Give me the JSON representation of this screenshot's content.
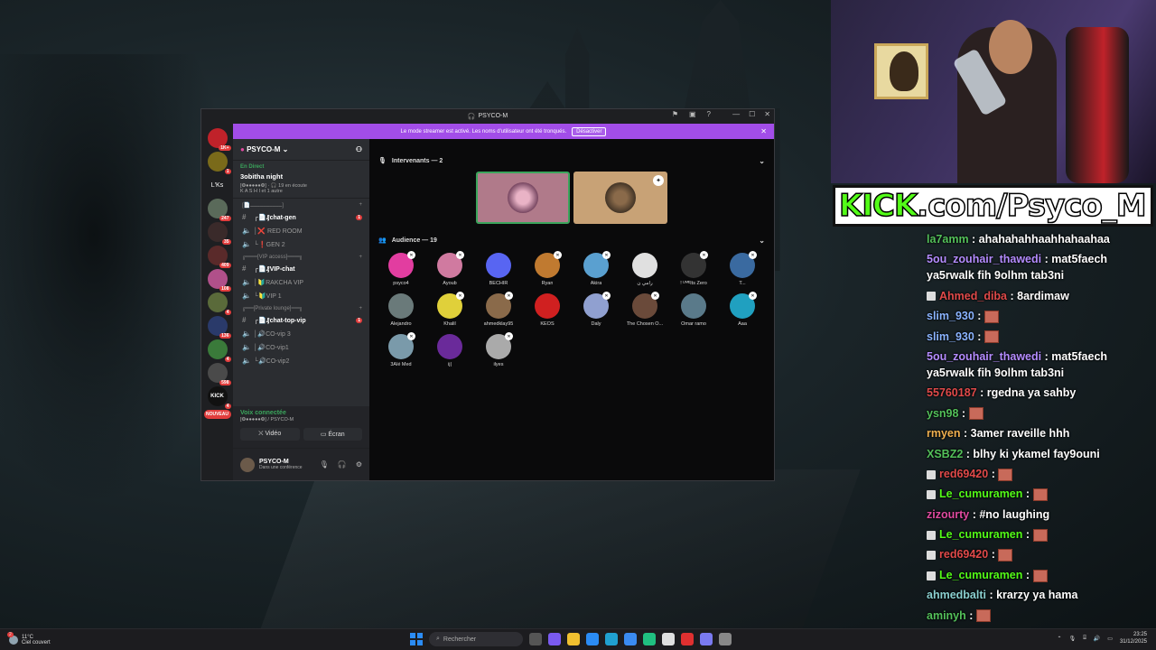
{
  "discord": {
    "window_title": "PSYCO-M",
    "streamer_banner": "Le mode streamer est activé. Les noms d'utilisateur ont été tronqués.",
    "streamer_button": "Désactiver",
    "guilds": [
      {
        "label": "",
        "badge": "1K+",
        "color": "#c0222a"
      },
      {
        "label": "",
        "badge": "1",
        "color": "#7a6a1a"
      },
      {
        "label": "L'Ks",
        "badge": "",
        "color": "transparent"
      },
      {
        "label": "",
        "badge": "247",
        "color": "#5a6a5a"
      },
      {
        "label": "",
        "badge": "35",
        "color": "#3a2a2a"
      },
      {
        "label": "",
        "badge": "409",
        "color": "#5a2a2a"
      },
      {
        "label": "",
        "badge": "108",
        "color": "#b0508a"
      },
      {
        "label": "",
        "badge": "4",
        "color": "#5a6a3a"
      },
      {
        "label": "",
        "badge": "136",
        "color": "#2a3a6a"
      },
      {
        "label": "",
        "badge": "4",
        "color": "#3a7a3a"
      },
      {
        "label": "",
        "badge": "598",
        "color": "#4a4a4a"
      },
      {
        "label": "KICK",
        "badge": "4",
        "color": "#111"
      }
    ],
    "new_label": "NOUVEAU",
    "server_name": "PSYCO-M",
    "live": {
      "label": "En Direct",
      "event": "3obitha night",
      "meta": "[❂●●●●●❂] · 🎧 19 en écoute",
      "participants": "K A S H I et 1 autre"
    },
    "categories": [
      {
        "name": "[📄ــــــــــــــــــــ]",
        "channels": [
          {
            "type": "text",
            "name": "┌📄₰chat-gen",
            "bold": true,
            "badge": "1"
          },
          {
            "type": "voice",
            "name": "│❌ RED ROOM",
            "bold": false,
            "badge": ""
          },
          {
            "type": "voice",
            "name": "└❗GEN 2",
            "bold": false,
            "badge": ""
          }
        ]
      },
      {
        "name": "╔═══[VIP access]═══╗",
        "channels": [
          {
            "type": "text",
            "name": "┌📄₰VIP-chat",
            "bold": true,
            "badge": ""
          },
          {
            "type": "voice",
            "name": "│🔰RAKCHA VIP",
            "bold": false,
            "badge": ""
          },
          {
            "type": "voice",
            "name": "└🔰VIP 1",
            "bold": false,
            "badge": ""
          }
        ]
      },
      {
        "name": "╔══[Private lounge]══╗",
        "channels": [
          {
            "type": "text",
            "name": "┌📄₰chat-top-vip",
            "bold": true,
            "badge": "1"
          },
          {
            "type": "voice",
            "name": "│🔊CO-vip 3",
            "bold": false,
            "badge": ""
          },
          {
            "type": "voice",
            "name": "│🔊CO-vip1",
            "bold": false,
            "badge": ""
          },
          {
            "type": "voice",
            "name": "└🔊CO-vip2",
            "bold": false,
            "badge": ""
          }
        ]
      }
    ],
    "voice": {
      "status": "Voix connectée",
      "location": "[❂●●●●●❂] / PSYCO-M",
      "video_label": "Vidéo",
      "screen_label": "Écran"
    },
    "user": {
      "name": "PSYCO-M",
      "status": "Dans une conférence"
    },
    "speakers_header": "Intervenants — 2",
    "audience_header": "Audience — 19",
    "audience": [
      {
        "name": "psyco4",
        "color": "#e23da0"
      },
      {
        "name": "Ayoub",
        "color": "#d07aa0"
      },
      {
        "name": "BECHIR",
        "color": "#5865f2"
      },
      {
        "name": "Ryan",
        "color": "#c07a30"
      },
      {
        "name": "Akira",
        "color": "#5aa0d0"
      },
      {
        "name": "رامي ن",
        "color": "#e0e0e0"
      },
      {
        "name": "! ᴸᴵᴹᴱIts Zero",
        "color": "#333"
      },
      {
        "name": "T...",
        "color": "#3a6aa0"
      },
      {
        "name": "Alejandro",
        "color": "#6a7a7a"
      },
      {
        "name": "Khalil",
        "color": "#e0d03a"
      },
      {
        "name": "ahmedklay95",
        "color": "#8a6a4a"
      },
      {
        "name": "KEOS",
        "color": "#d02020"
      },
      {
        "name": "Daly",
        "color": "#90a0d0"
      },
      {
        "name": "The Chosen O...",
        "color": "#6a4a3a"
      },
      {
        "name": "Omar ramo",
        "color": "#5a7a8a"
      },
      {
        "name": "Aaa",
        "color": "#20a0c0"
      },
      {
        "name": "3Alé Med",
        "color": "#7a9aaa"
      },
      {
        "name": "ij|",
        "color": "#6a2a9a"
      },
      {
        "name": "ilyes",
        "color": "#aaa"
      }
    ]
  },
  "stream": {
    "kick_prefix": "KICK",
    "kick_rest": ".com/Psyco_M"
  },
  "chat": [
    {
      "user": "la7amm",
      "color": "#53c05a",
      "text": "ahahahahhaahhahaahaa",
      "emote": false,
      "badge": false
    },
    {
      "user": "5ou_zouhair_thawedi",
      "color": "#b48cff",
      "text": "mat5faech ya5rwalk fih 9olhm tab3ni",
      "emote": false,
      "badge": false
    },
    {
      "user": "Ahmed_diba",
      "color": "#e04a4a",
      "text": "8ardimaw",
      "emote": false,
      "badge": true
    },
    {
      "user": "slim_930",
      "color": "#8ab4ff",
      "text": "",
      "emote": true,
      "badge": false
    },
    {
      "user": "slim_930",
      "color": "#8ab4ff",
      "text": "",
      "emote": true,
      "badge": false
    },
    {
      "user": "5ou_zouhair_thawedi",
      "color": "#b48cff",
      "text": "mat5faech ya5rwalk fih 9olhm tab3ni",
      "emote": false,
      "badge": false
    },
    {
      "user": "55760187",
      "color": "#e04a4a",
      "text": "rgedna ya sahby",
      "emote": false,
      "badge": false
    },
    {
      "user": "ysn98",
      "color": "#53c05a",
      "text": "",
      "emote": true,
      "badge": false
    },
    {
      "user": "rmyen",
      "color": "#f0b050",
      "text": "3amer raveille hhh",
      "emote": false,
      "badge": false
    },
    {
      "user": "XSBZ2",
      "color": "#53c05a",
      "text": "blhy ki ykamel fay9ouni",
      "emote": false,
      "badge": false
    },
    {
      "user": "red69420",
      "color": "#e04a4a",
      "text": "",
      "emote": true,
      "badge": true
    },
    {
      "user": "Le_cumuramen",
      "color": "#53fc18",
      "text": "",
      "emote": true,
      "badge": true
    },
    {
      "user": "zizourty",
      "color": "#e04aa0",
      "text": "#no laughing",
      "emote": false,
      "badge": false
    },
    {
      "user": "Le_cumuramen",
      "color": "#53fc18",
      "text": "",
      "emote": true,
      "badge": true
    },
    {
      "user": "red69420",
      "color": "#e04a4a",
      "text": "",
      "emote": true,
      "badge": true
    },
    {
      "user": "Le_cumuramen",
      "color": "#53fc18",
      "text": "",
      "emote": true,
      "badge": true
    },
    {
      "user": "ahmedbalti",
      "color": "#8ad0d0",
      "text": "krarzy ya hama",
      "emote": false,
      "badge": false
    },
    {
      "user": "aminyh",
      "color": "#53c05a",
      "text": "",
      "emote": true,
      "badge": false
    }
  ],
  "taskbar": {
    "weather_temp": "11°C",
    "weather_desc": "Ciel couvert",
    "weather_badge": "2",
    "search_placeholder": "Rechercher",
    "time": "23:25",
    "date": "31/12/2025",
    "apps": [
      "#555",
      "#7a5af0",
      "#f0c030",
      "#2b8cf5",
      "#20a0d0",
      "#3a8af0",
      "#20c080",
      "#e0e0e0",
      "#e03030",
      "#7a7af0",
      "#888"
    ]
  }
}
